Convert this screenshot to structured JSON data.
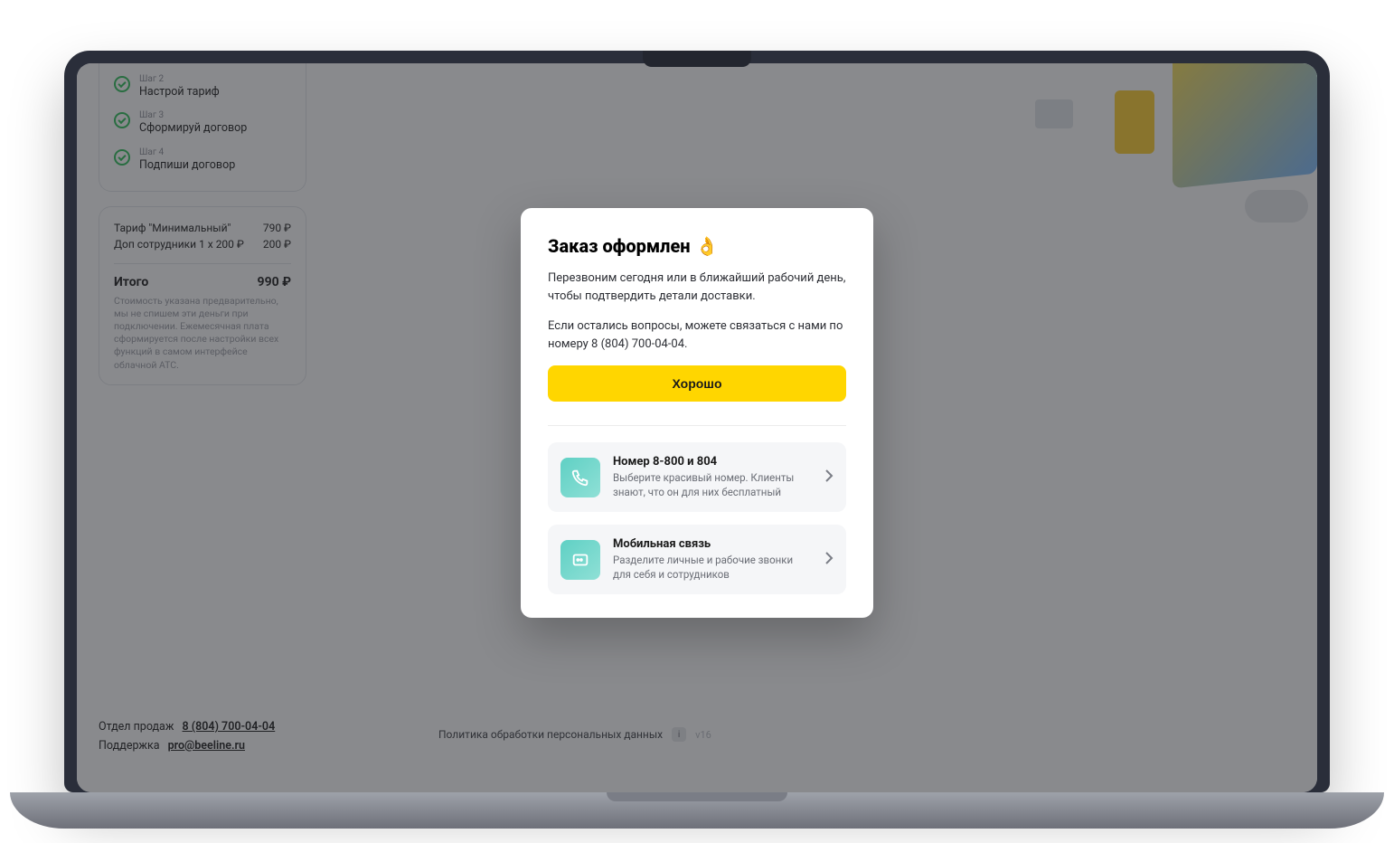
{
  "sidebar": {
    "steps": [
      {
        "kicker": "Шаг 2",
        "title": "Настрой тариф"
      },
      {
        "kicker": "Шаг 3",
        "title": "Сформируй договор"
      },
      {
        "kicker": "Шаг 4",
        "title": "Подпиши договор"
      }
    ]
  },
  "pricing": {
    "lines": [
      {
        "label": "Тариф \"Минимальный\"",
        "value": "790 ₽"
      },
      {
        "label": "Доп сотрудники 1 x 200 ₽",
        "value": "200 ₽"
      }
    ],
    "total_label": "Итого",
    "total_value": "990 ₽",
    "note": "Стоимость указана предварительно, мы не спишем эти деньги при подключении. Ежемесячная плата сформируется после настройки всех функций в самом интерфейсе облачной АТС."
  },
  "footer": {
    "sales_label": "Отдел продаж",
    "sales_phone": "8 (804) 700-04-04",
    "support_label": "Поддержка",
    "support_email": "pro@beeline.ru",
    "policy": "Политика обработки персональных данных",
    "info_glyph": "i",
    "version": "v16"
  },
  "modal": {
    "title": "Заказ оформлен",
    "emoji": "👌",
    "p1": "Перезвоним сегодня или в ближайший рабочий день, чтобы подтвердить детали доставки.",
    "p2": "Если остались вопросы, можете связаться с нами по номеру 8 (804) 700-04-04.",
    "button": "Хорошо",
    "offers": [
      {
        "title": "Номер 8-800 и 804",
        "desc": "Выберите красивый номер. Клиенты знают, что он для них бесплатный"
      },
      {
        "title": "Мобильная связь",
        "desc": "Разделите личные и рабочие звонки для себя и сотрудников"
      }
    ]
  }
}
